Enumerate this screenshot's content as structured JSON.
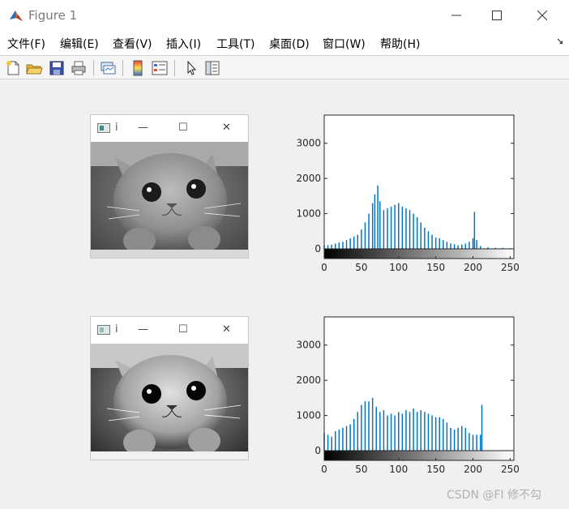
{
  "window": {
    "title": "Figure 1",
    "min_icon": "minimize-icon",
    "max_icon": "maximize-icon",
    "close_icon": "close-icon"
  },
  "menu": [
    "文件(F)",
    "编辑(E)",
    "查看(V)",
    "插入(I)",
    "工具(T)",
    "桌面(D)",
    "窗口(W)",
    "帮助(H)"
  ],
  "menu_dock_glyph": "↘",
  "toolbar": [
    "new-figure-icon",
    "open-file-icon",
    "save-icon",
    "print-icon",
    "link-plot-icon",
    "insert-colorbar-icon",
    "insert-legend-icon",
    "edit-plot-arrow-icon",
    "property-inspector-icon"
  ],
  "subwindows": [
    {
      "title": "i"
    },
    {
      "title": "i"
    }
  ],
  "chart_data": [
    {
      "type": "bar",
      "title": "",
      "xlabel": "",
      "ylabel": "",
      "xlim": [
        0,
        255
      ],
      "ylim": [
        0,
        3800
      ],
      "xticks": [
        "0",
        "50",
        "100",
        "150",
        "200",
        "250"
      ],
      "yticks": [
        "0",
        "1000",
        "2000",
        "3000"
      ],
      "bar_color": "#0072bd",
      "colorbar": "gray",
      "series": [
        {
          "x": [
            0,
            5,
            10,
            15,
            20,
            25,
            30,
            35,
            40,
            45,
            50,
            55,
            60,
            65,
            68,
            72,
            75,
            80,
            85,
            90,
            95,
            100,
            105,
            110,
            115,
            120,
            125,
            130,
            135,
            140,
            145,
            150,
            155,
            160,
            165,
            170,
            175,
            180,
            185,
            190,
            195,
            200,
            202,
            205,
            210,
            220,
            230,
            240,
            250
          ],
          "values": [
            100,
            100,
            120,
            150,
            180,
            200,
            250,
            300,
            350,
            400,
            550,
            750,
            1000,
            1300,
            1550,
            1800,
            1350,
            1100,
            1150,
            1200,
            1250,
            1300,
            1200,
            1150,
            1100,
            1000,
            900,
            750,
            600,
            500,
            400,
            320,
            300,
            250,
            200,
            150,
            130,
            100,
            120,
            150,
            200,
            300,
            1050,
            250,
            80,
            40,
            30,
            30,
            20
          ]
        }
      ]
    },
    {
      "type": "bar",
      "title": "",
      "xlabel": "",
      "ylabel": "",
      "xlim": [
        0,
        255
      ],
      "ylim": [
        0,
        3800
      ],
      "xticks": [
        "0",
        "50",
        "100",
        "150",
        "200",
        "250"
      ],
      "yticks": [
        "0",
        "1000",
        "2000",
        "3000"
      ],
      "bar_color": "#0072bd",
      "colorbar": "gray",
      "series": [
        {
          "x": [
            0,
            5,
            10,
            15,
            20,
            25,
            30,
            35,
            40,
            45,
            50,
            55,
            60,
            65,
            70,
            75,
            80,
            85,
            90,
            95,
            100,
            105,
            110,
            115,
            120,
            125,
            130,
            135,
            140,
            145,
            150,
            155,
            160,
            165,
            170,
            175,
            180,
            185,
            190,
            195,
            200,
            205,
            210,
            212,
            215
          ],
          "values": [
            500,
            450,
            400,
            550,
            600,
            650,
            700,
            750,
            900,
            1100,
            1300,
            1400,
            1400,
            1500,
            1250,
            1100,
            1150,
            1000,
            1050,
            1000,
            1100,
            1050,
            1150,
            1100,
            1200,
            1100,
            1150,
            1100,
            1050,
            1000,
            950,
            950,
            900,
            800,
            650,
            600,
            650,
            700,
            650,
            500,
            450,
            450,
            450,
            1300,
            0
          ]
        }
      ]
    }
  ],
  "watermark": "CSDN @FI 修不勾"
}
